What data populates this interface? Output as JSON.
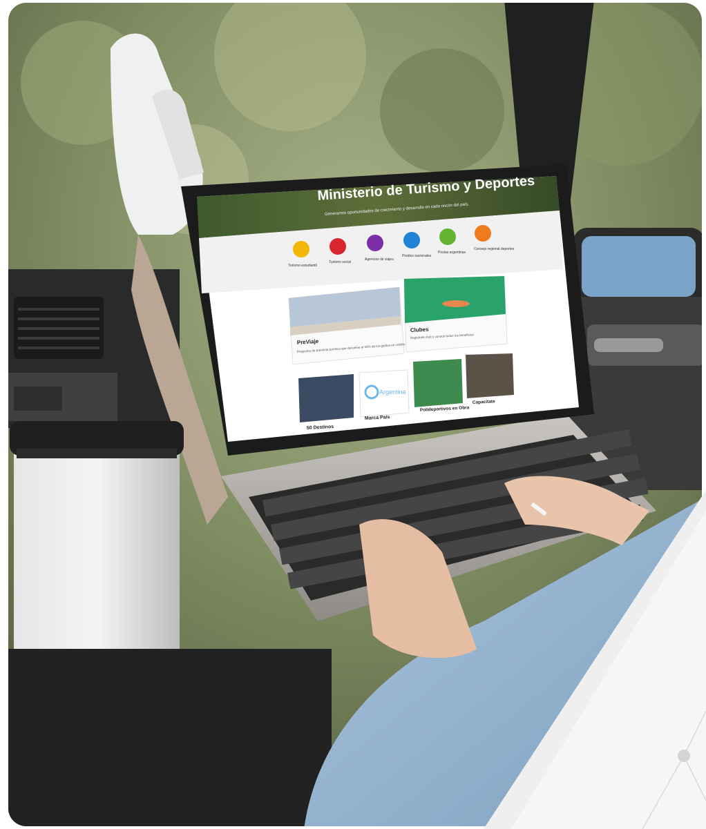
{
  "site": {
    "title": "Ministerio de Turismo y Deportes",
    "subtitle": "Generamos oportunidades de crecimiento y desarrollo en cada rincón del país."
  },
  "categories": [
    {
      "label": "Turismo estudiantil",
      "color": "#f2b705",
      "icon": "walking-icon"
    },
    {
      "label": "Turismo social",
      "color": "#d8262f",
      "icon": "people-icon"
    },
    {
      "label": "Agencias de viajes",
      "color": "#7b2fa6",
      "icon": "document-icon"
    },
    {
      "label": "Predios nacionales",
      "color": "#1f84d6",
      "icon": "location-icon"
    },
    {
      "label": "Postas argentinas",
      "color": "#63b531",
      "icon": "bottle-icon"
    },
    {
      "label": "Consejo regional deportes",
      "color": "#ef7b1c",
      "icon": "clipboard-icon"
    }
  ],
  "cards": {
    "previaje": {
      "title": "PreViaje",
      "text": "Programa de preventa turística que devuelve el 50% de los gastos en crédito."
    },
    "clubes": {
      "title": "Clubes",
      "text": "Registrate club y conocé todos los beneficios"
    },
    "destinos": {
      "title": "50 Destinos"
    },
    "marca": {
      "title": "Marca País",
      "logo_text": "Argentina"
    },
    "polideportivos": {
      "title": "Polideportivos en Obra"
    },
    "capacitate": {
      "title": "Capacitate"
    }
  }
}
